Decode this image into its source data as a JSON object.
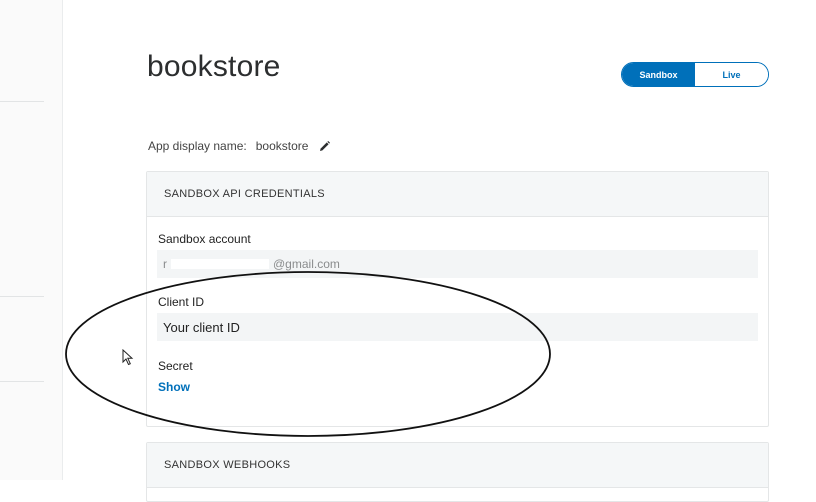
{
  "app": {
    "title": "bookstore"
  },
  "env_toggle": {
    "options": [
      "Sandbox",
      "Live"
    ],
    "active": "Sandbox"
  },
  "display_name": {
    "label": "App display name:",
    "value": "bookstore"
  },
  "credentials_panel": {
    "header": "SANDBOX API CREDENTIALS",
    "sandbox_account": {
      "label": "Sandbox account",
      "value_visible_prefix": "r",
      "value_visible_suffix": "@gmail.com"
    },
    "client_id": {
      "label": "Client ID",
      "value": "Your client ID"
    },
    "secret": {
      "label": "Secret",
      "action": "Show"
    }
  },
  "webhooks_panel": {
    "header": "SANDBOX WEBHOOKS"
  },
  "colors": {
    "accent": "#0070ba",
    "annotation": "#111111"
  },
  "icons": {
    "edit": "pencil-icon",
    "cursor": "mouse-pointer-icon"
  }
}
